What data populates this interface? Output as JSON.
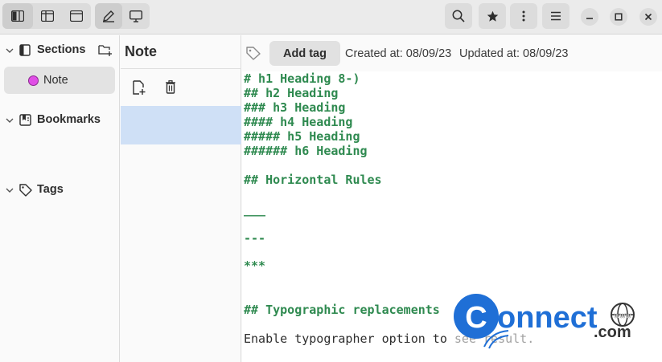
{
  "header": {
    "buttons": [
      {
        "name": "sidebar-layout-1",
        "icon": "sidebar-full-icon"
      },
      {
        "name": "sidebar-layout-2",
        "icon": "sidebar-half-icon"
      },
      {
        "name": "sidebar-layout-3",
        "icon": "sidebar-none-icon"
      },
      {
        "name": "edit-mode",
        "icon": "pen-icon"
      },
      {
        "name": "preview-mode",
        "icon": "monitor-icon"
      }
    ],
    "right_buttons": [
      "search-icon",
      "star-icon",
      "kebab-menu-icon",
      "hamburger-menu-icon"
    ],
    "window_controls": [
      "minimize-icon",
      "maximize-icon",
      "close-icon"
    ]
  },
  "sidebar": {
    "sections_label": "Sections",
    "note_label": "Note",
    "note_color": "#e04ee6",
    "bookmarks_label": "Bookmarks",
    "tags_label": "Tags"
  },
  "notelist": {
    "title": "Note",
    "selected_color": "#cfe0f6"
  },
  "editor": {
    "add_tag_label": "Add tag",
    "created": "Created at: 08/09/23",
    "updated": "Updated at: 08/09/23",
    "lines": {
      "l1": "# h1 Heading 8-)",
      "l2": "## h2 Heading",
      "l3": "### h3 Heading",
      "l4": "#### h4 Heading",
      "l5": "##### h5 Heading",
      "l6": "###### h6 Heading",
      "l7": "## Horizontal Rules",
      "l8": "___",
      "l9": "---",
      "l10": "***",
      "l11": "## Typographic replacements",
      "l12": "Enable typographer option to see result."
    },
    "heading_color": "#2f8a50"
  },
  "watermark": {
    "big": "onnect",
    "small": ".com",
    "letter": "C",
    "globe": "www"
  }
}
